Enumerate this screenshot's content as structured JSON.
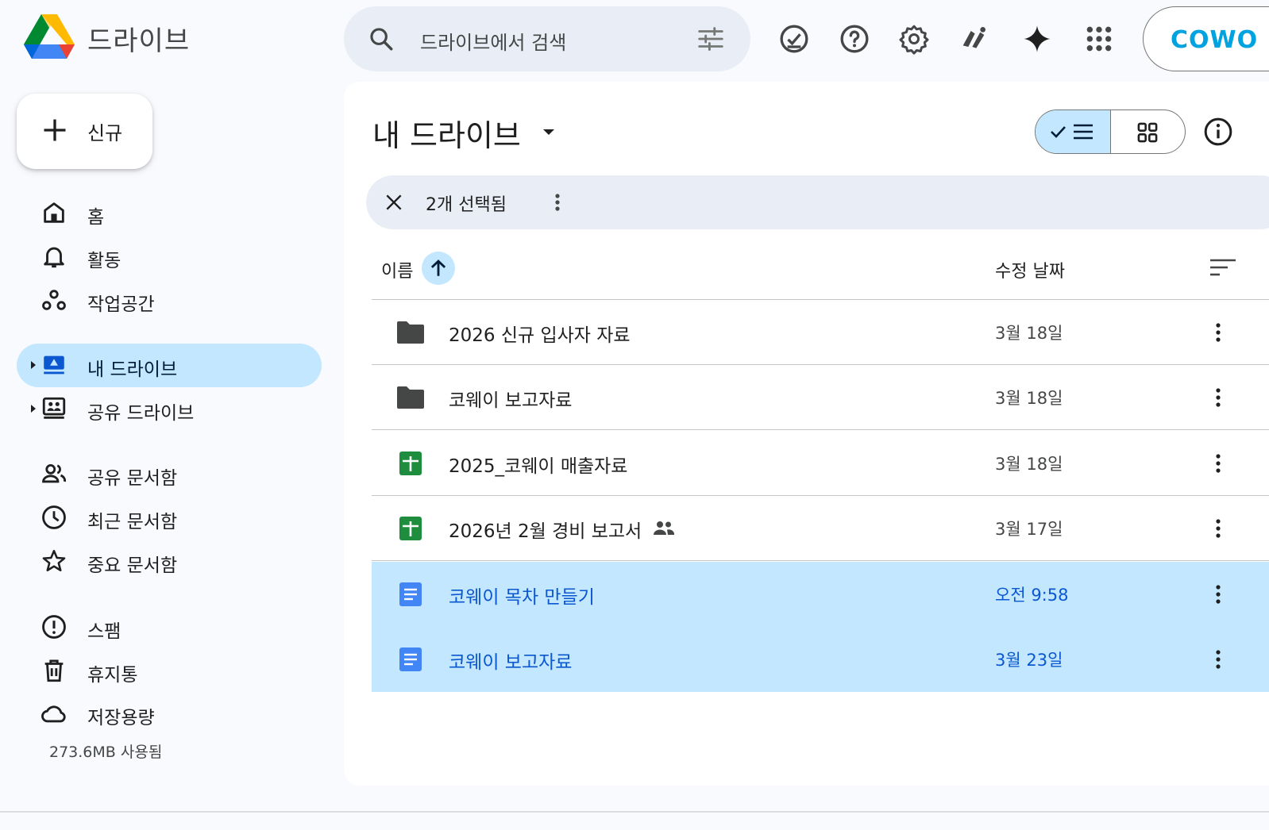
{
  "app": {
    "title": "드라이브"
  },
  "search": {
    "placeholder": "드라이브에서 검색"
  },
  "header": {
    "icons": [
      "offline-ready-icon",
      "help-icon",
      "settings-icon",
      "gemini-extensions-icon",
      "gemini-spark-icon",
      "apps-grid-icon"
    ],
    "account_brand": "COWO"
  },
  "sidebar": {
    "new_label": "신규",
    "items": [
      {
        "label": "홈",
        "icon": "home-icon"
      },
      {
        "label": "활동",
        "icon": "bell-icon"
      },
      {
        "label": "작업공간",
        "icon": "workspaces-icon"
      },
      {
        "label": "내 드라이브",
        "icon": "my-drive-icon",
        "active": true
      },
      {
        "label": "공유 드라이브",
        "icon": "shared-drives-icon"
      },
      {
        "label": "공유 문서함",
        "icon": "people-icon"
      },
      {
        "label": "최근 문서함",
        "icon": "clock-icon"
      },
      {
        "label": "중요 문서함",
        "icon": "star-icon"
      },
      {
        "label": "스팸",
        "icon": "spam-icon"
      },
      {
        "label": "휴지통",
        "icon": "trash-icon"
      },
      {
        "label": "저장용량",
        "icon": "cloud-icon"
      }
    ],
    "storage_used": "273.6MB 사용됨"
  },
  "main": {
    "title": "내 드라이브",
    "selection": {
      "text": "2개 선택됨"
    },
    "columns": {
      "name": "이름",
      "modified": "수정 날짜"
    },
    "files": [
      {
        "name": "2026 신규 입사자 자료",
        "type": "folder",
        "date": "3월 18일",
        "selected": false,
        "shared": false
      },
      {
        "name": "코웨이 보고자료",
        "type": "folder",
        "date": "3월 18일",
        "selected": false,
        "shared": false
      },
      {
        "name": "2025_코웨이 매출자료",
        "type": "sheets",
        "date": "3월 18일",
        "selected": false,
        "shared": false
      },
      {
        "name": "2026년 2월 경비 보고서",
        "type": "sheets",
        "date": "3월 17일",
        "selected": false,
        "shared": true
      },
      {
        "name": "코웨이 목차 만들기",
        "type": "docs",
        "date": "오전 9:58",
        "selected": true,
        "shared": false
      },
      {
        "name": "코웨이 보고자료",
        "type": "docs",
        "date": "3월 23일",
        "selected": true,
        "shared": false
      }
    ]
  },
  "colors": {
    "background": "#f8fafd",
    "selected_row": "#c2e7ff",
    "accent_blue": "#0b57d0",
    "search_bg": "#e9eef6",
    "sheets_green": "#1e8e3e",
    "docs_blue": "#4285f4",
    "folder_gray": "#444746"
  }
}
